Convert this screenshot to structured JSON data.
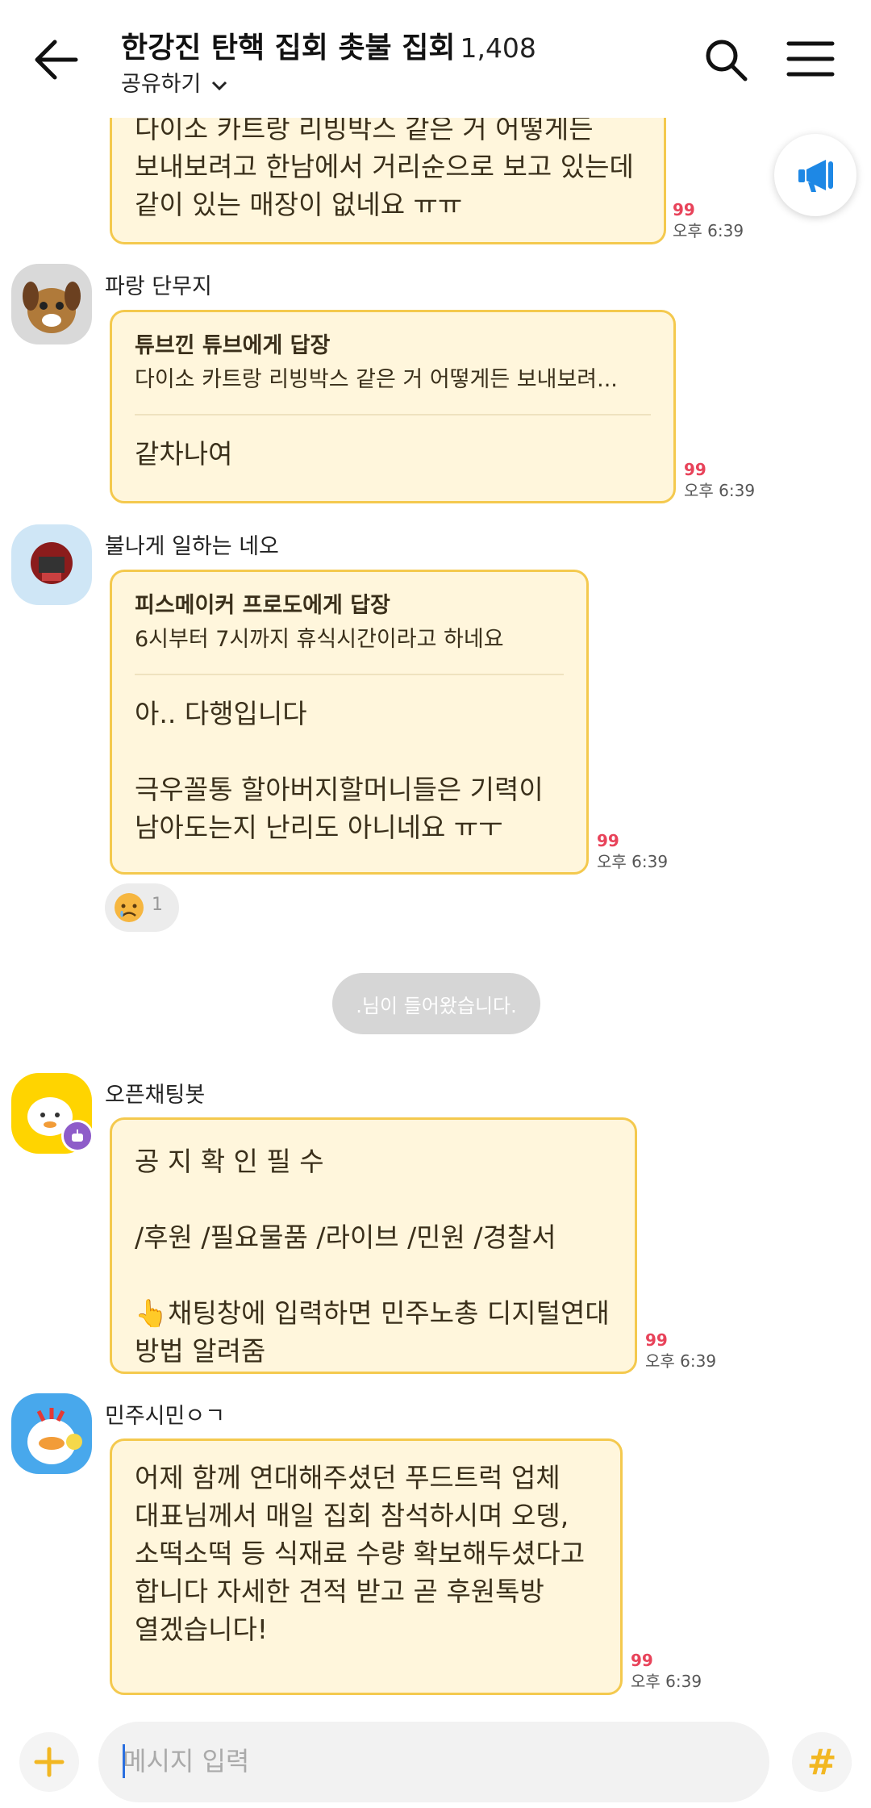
{
  "header": {
    "title": "한강진 탄핵 집회 촛불 집회",
    "member_count": "1,408",
    "share_label": "공유하기"
  },
  "messages": [
    {
      "text": "다이소 카트랑 리빙박스 같은 거 어떻게든\n보내보려고 한남에서 거리순으로 보고 있는데\n같이 있는 매장이 없네요 ㅠㅠ",
      "read": "99",
      "time": "오후 6:39"
    },
    {
      "sender": "파랑 단무지",
      "reply_head": "튜브낀 튜브에게 답장",
      "reply_quote": "다이소 카트랑 리빙박스 같은 거 어떻게든 보내보려...",
      "text": "같차나여",
      "read": "99",
      "time": "오후 6:39"
    },
    {
      "sender": "불나게 일하는 네오",
      "reply_head": "피스메이커 프로도에게 답장",
      "reply_quote": "6시부터 7시까지 휴식시간이라고 하네요",
      "text": "아.. 다행입니다\n\n극우꼴통 할아버지할머니들은 기력이\n남아도는지 난리도 아니네요 ㅠㅜ",
      "read": "99",
      "time": "오후 6:39",
      "reaction_count": "1"
    },
    {
      "sender": "오픈채팅봇",
      "text": "공 지 확 인 필 수\n\n/후원 /필요물품 /라이브 /민원 /경찰서\n\n👆채팅창에 입력하면 민주노총 디지털연대\n방법 알려줌",
      "read": "99",
      "time": "오후 6:39"
    },
    {
      "sender": "민주시민ㅇㄱ",
      "text": "어제 함께 연대해주셨던 푸드트럭 업체\n대표님께서 매일 집회 참석하시며 오뎅,\n소떡소떡 등 식재료 수량 확보해두셨다고\n합니다 자세한 견적 받고 곧 후원톡방\n열겠습니다!",
      "read": "99",
      "time": "오후 6:39"
    }
  ],
  "system_message": ".님이 들어왔습니다.",
  "input": {
    "placeholder": "메시지 입력"
  },
  "colors": {
    "bubble_bg": "#fff6dc",
    "bubble_border": "#f4c94e",
    "read_count": "#e8435a",
    "notice_icon": "#1e88e5",
    "hash": "#f2b722"
  }
}
